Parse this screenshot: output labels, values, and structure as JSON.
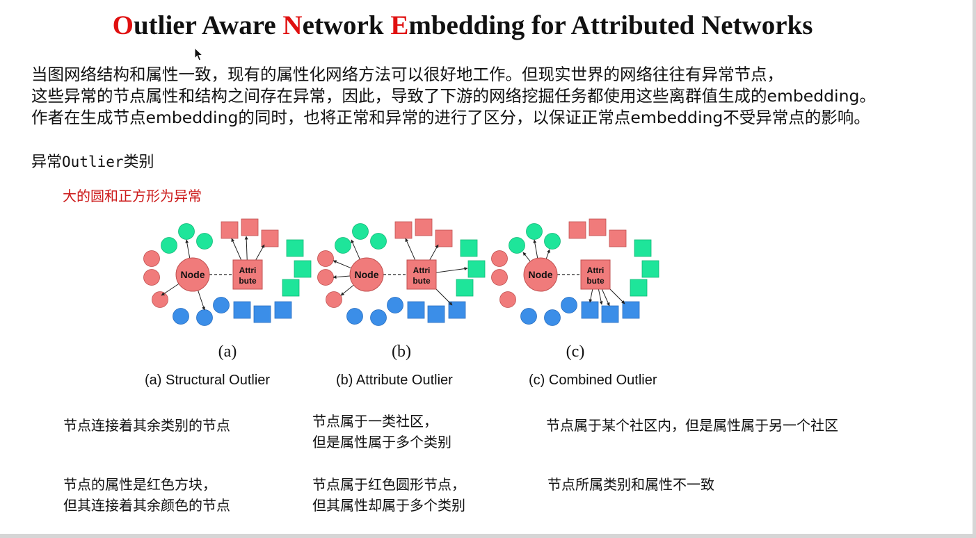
{
  "title": {
    "segments": [
      {
        "text": "O",
        "highlight": true
      },
      {
        "text": "utlier Aware ",
        "highlight": false
      },
      {
        "text": "N",
        "highlight": true
      },
      {
        "text": "etwork ",
        "highlight": false
      },
      {
        "text": "E",
        "highlight": true
      },
      {
        "text": "mbedding for Attributed Networks",
        "highlight": false
      }
    ],
    "highlight_color": "#e01010"
  },
  "intro": {
    "lines": [
      "当图网络结构和属性一致，现有的属性化网络方法可以很好地工作。但现实世界的网络往往有异常节点，",
      "这些异常的节点属性和结构之间存在异常，因此，导致了下游的网络挖掘任务都使用这些离群值生成的embedding。",
      "作者在生成节点embedding的同时，也将正常和异常的进行了区分，以保证正常点embedding不受异常点的影响。"
    ]
  },
  "section_heading": {
    "prefix": "异常",
    "mono": "Outlier",
    "suffix": "类别"
  },
  "red_note": "大的圆和正方形为异常",
  "figure": {
    "node_label": "Node",
    "attribute_label_line1": "Attri",
    "attribute_label_line2": "bute",
    "panel_labels": [
      "(a)",
      "(b)",
      "(c)"
    ],
    "colors": {
      "red": "#f07b7b",
      "green": "#1ee59a",
      "blue": "#3b8ee8",
      "stroke_red": "#c05050"
    }
  },
  "captions": [
    "(a) Structural Outlier",
    "(b) Attribute Outlier",
    "(c) Combined Outlier"
  ],
  "descriptions": {
    "row1": [
      [
        "节点连接着其余类别的节点"
      ],
      [
        "节点属于一类社区，",
        "但是属性属于多个类别"
      ],
      [
        "节点属于某个社区内，但是属性属于另一个社区"
      ]
    ],
    "row2": [
      [
        "节点的属性是红色方块，",
        "但其连接着其余颜色的节点"
      ],
      [
        "节点属于红色圆形节点，",
        "但其属性却属于多个类别"
      ],
      [
        "节点所属类别和属性不一致"
      ]
    ]
  }
}
